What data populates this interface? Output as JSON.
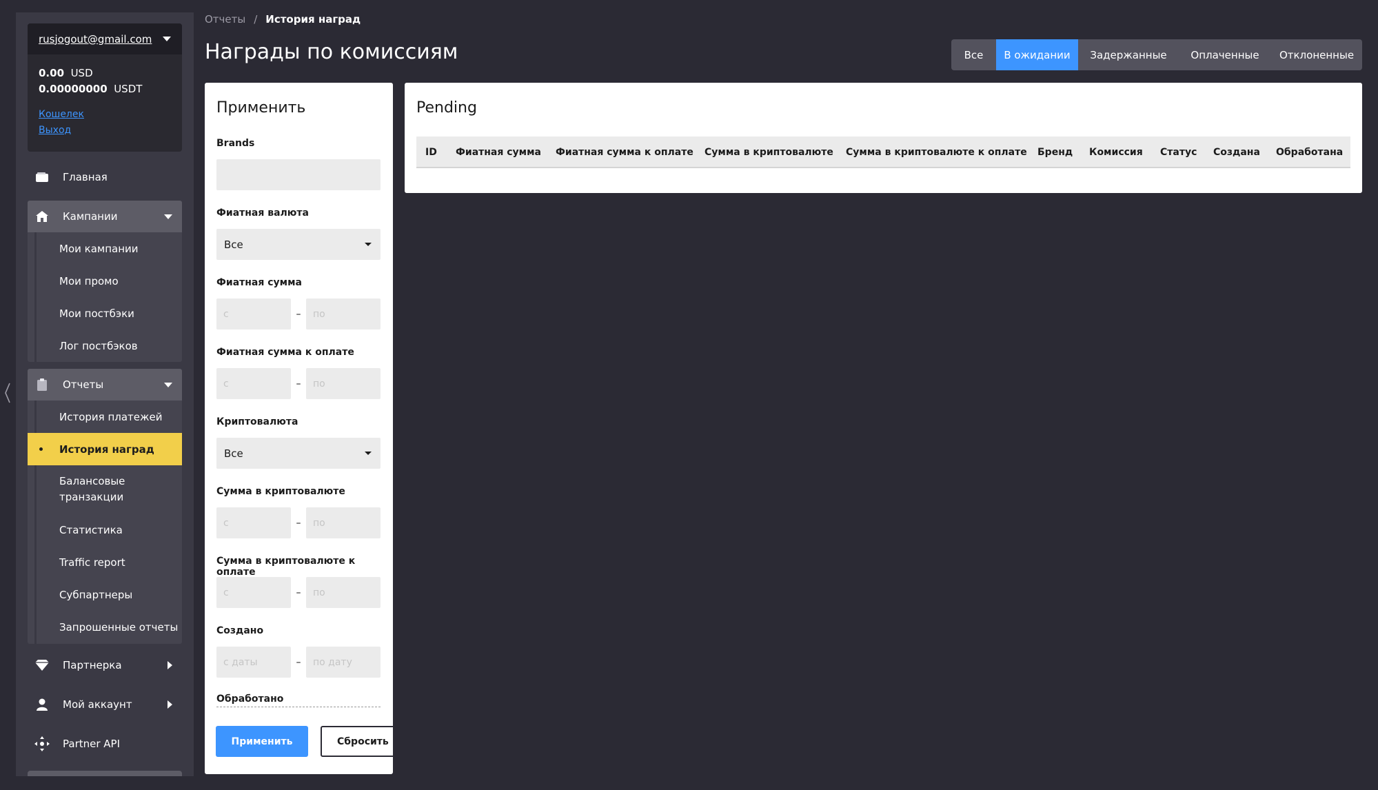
{
  "sidebar": {
    "account": {
      "email": "rusjogout@gmail.com",
      "balances": [
        {
          "amount": "0.00",
          "currency": "USD"
        },
        {
          "amount": "0.00000000",
          "currency": "USDT"
        }
      ],
      "wallet_link": "Кошелек",
      "logout_link": "Выход"
    },
    "home": {
      "label": "Главная",
      "icon": "wallet-icon"
    },
    "campaigns": {
      "label": "Кампании",
      "icon": "home-icon",
      "items": [
        "Мои кампании",
        "Мои промо",
        "Мои постбэки",
        "Лог постбэков"
      ]
    },
    "reports": {
      "label": "Отчеты",
      "icon": "clipboard-icon",
      "items": [
        "История платежей",
        "История наград",
        "Балансовые транзакции",
        "Статистика",
        "Traffic report",
        "Субпартнеры",
        "Запрошенные отчеты"
      ],
      "active_item": "История наград"
    },
    "partner": {
      "label": "Партнерка",
      "icon": "diamond-icon"
    },
    "account_menu": {
      "label": "Мой аккаунт",
      "icon": "user-icon"
    },
    "api": {
      "label": "Partner API",
      "icon": "api-icon"
    }
  },
  "breadcrumb": {
    "parent": "Отчеты",
    "separator": "/",
    "current": "История наград"
  },
  "page_title": "Награды по комиссиям",
  "status_tabs": {
    "items": [
      "Все",
      "В ожидании",
      "Задержанные",
      "Оплаченные",
      "Отклоненные"
    ],
    "active": "В ожидании"
  },
  "filters": {
    "title": "Применить",
    "brands_label": "Brands",
    "fiat_currency_label": "Фиатная валюта",
    "fiat_currency_value": "Все",
    "fiat_amount_label": "Фиатная сумма",
    "fiat_amount_payable_label": "Фиатная сумма к оплате",
    "crypto_label": "Криптовалюта",
    "crypto_value": "Все",
    "crypto_amount_label": "Сумма в криптовалюте",
    "crypto_amount_payable_label": "Сумма в криптовалюте к оплате",
    "created_label": "Создано",
    "processed_label": "Обработано",
    "from_placeholder": "с",
    "to_placeholder": "по",
    "date_from_placeholder": "с даты",
    "date_to_placeholder": "по дату",
    "range_dash": "–",
    "apply_button": "Применить",
    "reset_button": "Сбросить"
  },
  "results": {
    "title": "Pending",
    "columns": [
      "ID",
      "Фиатная сумма",
      "Фиатная сумма к оплате",
      "Сумма в криптовалюте",
      "Сумма в криптовалюте к оплате",
      "Бренд",
      "Комиссия",
      "Статус",
      "Создана",
      "Обработана"
    ],
    "rows": []
  },
  "colors": {
    "background": "#2b2a34",
    "sidebar": "#3a3944",
    "accent_blue": "#3d95ff",
    "active_yellow": "#f2cf4a"
  }
}
